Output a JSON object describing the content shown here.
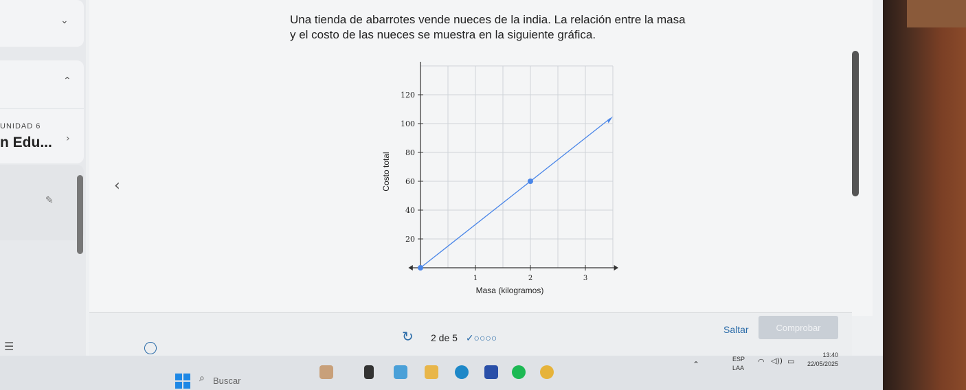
{
  "sidebar": {
    "course_title": "n Edu...",
    "unit_label": "UNIDAD 6"
  },
  "question": {
    "line1": "Una tienda de abarrotes vende nueces de la india. La relación entre la masa",
    "line2": "y el costo de las nueces se muestra en la siguiente gráfica."
  },
  "chart_data": {
    "type": "line",
    "xlabel": "Masa (kilogramos)",
    "ylabel": "Costo total",
    "x_ticks": [
      "1",
      "2",
      "3"
    ],
    "y_ticks": [
      "20",
      "40",
      "60",
      "80",
      "100",
      "120"
    ],
    "xlim": [
      0,
      3.5
    ],
    "ylim": [
      0,
      140
    ],
    "grid": true,
    "x": [
      0,
      2
    ],
    "y": [
      0,
      60
    ],
    "marked_points": [
      {
        "x": 0,
        "y": 0
      },
      {
        "x": 2,
        "y": 60
      }
    ],
    "line_color": "#4a86e8"
  },
  "footer": {
    "progress_text": "2 de 5",
    "progress_marks": "✓○○○○",
    "skip_label": "Saltar",
    "check_label": "Comprobar"
  },
  "taskbar": {
    "search_placeholder": "Buscar",
    "lang_top": "ESP",
    "lang_bottom": "LAA",
    "time": "13:40",
    "date": "22/05/2025"
  }
}
